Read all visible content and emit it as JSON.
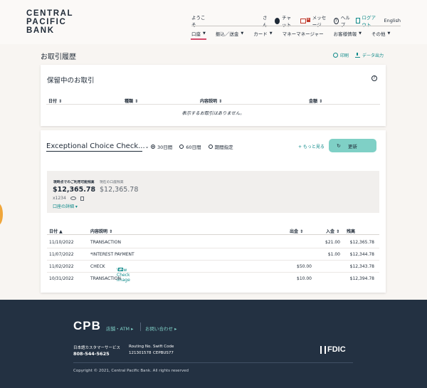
{
  "brand": {
    "logo_lines": [
      "CENTRAL",
      "PACIFIC",
      "BANK"
    ]
  },
  "topbar": {
    "welcome": "ようこそ",
    "san": "さん",
    "chat": "チャット",
    "messages": "メッセージ",
    "messages_badge": "8",
    "help": "ヘルプ",
    "logout": "ログアウト",
    "language": "English"
  },
  "nav": {
    "items": [
      {
        "label": "口座",
        "caret": "▼"
      },
      {
        "label": "振込／送金",
        "caret": "▼"
      },
      {
        "label": "カード",
        "caret": "▼"
      },
      {
        "label": "マネーマネージャー",
        "caret": ""
      },
      {
        "label": "お客様情報",
        "caret": "▼"
      },
      {
        "label": "その他",
        "caret": "▼"
      }
    ]
  },
  "page": {
    "title": "お取引履歴",
    "print": "印刷",
    "export": "データ出力"
  },
  "pending": {
    "title": "保留中のお取引",
    "help_icon": "?",
    "columns": [
      "日付 ⇕",
      "種類 ⇕",
      "内容説明 ⇕",
      "金額 ⇕"
    ],
    "empty": "表示するお取引はありません。"
  },
  "transactions": {
    "account": "Exceptional Choice Check...",
    "filters": [
      {
        "label": "30日間",
        "checked": true
      },
      {
        "label": "60日間",
        "checked": false
      },
      {
        "label": "期間指定",
        "checked": false
      }
    ],
    "more": "+ もっと見る",
    "refresh": "更新",
    "balance": {
      "available_label": "現時点でのご利用可能残高",
      "available_value": "$12,365.78",
      "current_label": "現在の口座残高",
      "current_value": "$12,365.78",
      "account_number": "x1234",
      "details_link": "口座の詳細 ▾"
    },
    "columns": {
      "date": "日付 ▲",
      "description": "内容説明 ⇕",
      "withdrawal": "出金 ⇕",
      "deposit": "入金 ⇕",
      "balance": "残高"
    },
    "rows": [
      {
        "date": "11/10/2022",
        "description": "TRANSACTION",
        "link": "",
        "withdrawal": "",
        "deposit": "$21.00",
        "balance": "$12,365.78"
      },
      {
        "date": "11/07/2022",
        "description": "*INTEREST PAYMENT",
        "link": "",
        "withdrawal": "",
        "deposit": "$1.00",
        "balance": "$12,344.78"
      },
      {
        "date": "11/02/2022",
        "description": "CHECK",
        "link": "View Check Image",
        "withdrawal": "$50.00",
        "deposit": "",
        "balance": "$12,343.78"
      },
      {
        "date": "10/31/2022",
        "description": "TRANSACTION",
        "link": "",
        "withdrawal": "$10.00",
        "deposit": "",
        "balance": "$12,394.78"
      }
    ]
  },
  "footer": {
    "logo": "CPB",
    "branches": "店舗・ATM  ▸",
    "contact": "お問い合わせ  ▸",
    "jp_service": "日本語カスタマーサービス",
    "phone": "808-544-5625",
    "routing_label": "Routing No.",
    "routing_value": "121301578",
    "swift_label": "Swift Code",
    "swift_value": "CEPBUS77",
    "fdic": "FDIC",
    "copyright": "Copyright © 2021, Central Pacific Bank. All rights reserved"
  },
  "colors": {
    "teal": "#0f8a8a",
    "refresh_button": "#7fd0c6",
    "footer_bg": "#233142",
    "nav_active": "#d44a6a"
  }
}
